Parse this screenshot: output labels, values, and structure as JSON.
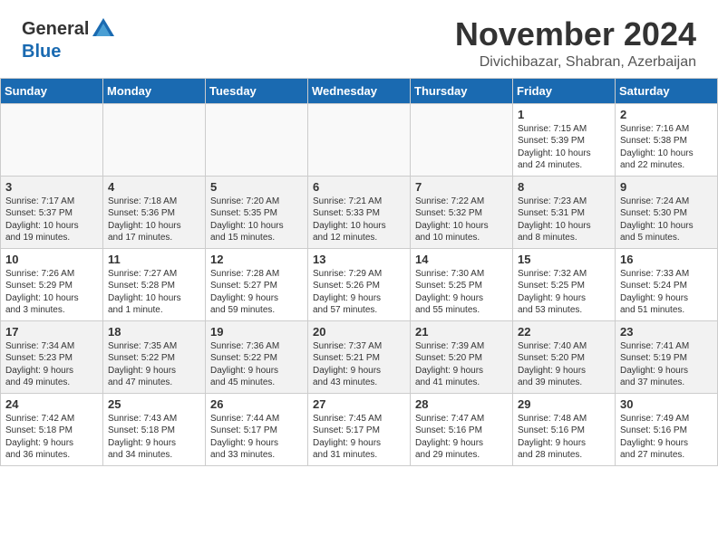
{
  "header": {
    "logo_general": "General",
    "logo_blue": "Blue",
    "month_title": "November 2024",
    "location": "Divichibazar, Shabran, Azerbaijan"
  },
  "days_of_week": [
    "Sunday",
    "Monday",
    "Tuesday",
    "Wednesday",
    "Thursday",
    "Friday",
    "Saturday"
  ],
  "weeks": [
    [
      {
        "day": "",
        "info": ""
      },
      {
        "day": "",
        "info": ""
      },
      {
        "day": "",
        "info": ""
      },
      {
        "day": "",
        "info": ""
      },
      {
        "day": "",
        "info": ""
      },
      {
        "day": "1",
        "info": "Sunrise: 7:15 AM\nSunset: 5:39 PM\nDaylight: 10 hours\nand 24 minutes."
      },
      {
        "day": "2",
        "info": "Sunrise: 7:16 AM\nSunset: 5:38 PM\nDaylight: 10 hours\nand 22 minutes."
      }
    ],
    [
      {
        "day": "3",
        "info": "Sunrise: 7:17 AM\nSunset: 5:37 PM\nDaylight: 10 hours\nand 19 minutes."
      },
      {
        "day": "4",
        "info": "Sunrise: 7:18 AM\nSunset: 5:36 PM\nDaylight: 10 hours\nand 17 minutes."
      },
      {
        "day": "5",
        "info": "Sunrise: 7:20 AM\nSunset: 5:35 PM\nDaylight: 10 hours\nand 15 minutes."
      },
      {
        "day": "6",
        "info": "Sunrise: 7:21 AM\nSunset: 5:33 PM\nDaylight: 10 hours\nand 12 minutes."
      },
      {
        "day": "7",
        "info": "Sunrise: 7:22 AM\nSunset: 5:32 PM\nDaylight: 10 hours\nand 10 minutes."
      },
      {
        "day": "8",
        "info": "Sunrise: 7:23 AM\nSunset: 5:31 PM\nDaylight: 10 hours\nand 8 minutes."
      },
      {
        "day": "9",
        "info": "Sunrise: 7:24 AM\nSunset: 5:30 PM\nDaylight: 10 hours\nand 5 minutes."
      }
    ],
    [
      {
        "day": "10",
        "info": "Sunrise: 7:26 AM\nSunset: 5:29 PM\nDaylight: 10 hours\nand 3 minutes."
      },
      {
        "day": "11",
        "info": "Sunrise: 7:27 AM\nSunset: 5:28 PM\nDaylight: 10 hours\nand 1 minute."
      },
      {
        "day": "12",
        "info": "Sunrise: 7:28 AM\nSunset: 5:27 PM\nDaylight: 9 hours\nand 59 minutes."
      },
      {
        "day": "13",
        "info": "Sunrise: 7:29 AM\nSunset: 5:26 PM\nDaylight: 9 hours\nand 57 minutes."
      },
      {
        "day": "14",
        "info": "Sunrise: 7:30 AM\nSunset: 5:25 PM\nDaylight: 9 hours\nand 55 minutes."
      },
      {
        "day": "15",
        "info": "Sunrise: 7:32 AM\nSunset: 5:25 PM\nDaylight: 9 hours\nand 53 minutes."
      },
      {
        "day": "16",
        "info": "Sunrise: 7:33 AM\nSunset: 5:24 PM\nDaylight: 9 hours\nand 51 minutes."
      }
    ],
    [
      {
        "day": "17",
        "info": "Sunrise: 7:34 AM\nSunset: 5:23 PM\nDaylight: 9 hours\nand 49 minutes."
      },
      {
        "day": "18",
        "info": "Sunrise: 7:35 AM\nSunset: 5:22 PM\nDaylight: 9 hours\nand 47 minutes."
      },
      {
        "day": "19",
        "info": "Sunrise: 7:36 AM\nSunset: 5:22 PM\nDaylight: 9 hours\nand 45 minutes."
      },
      {
        "day": "20",
        "info": "Sunrise: 7:37 AM\nSunset: 5:21 PM\nDaylight: 9 hours\nand 43 minutes."
      },
      {
        "day": "21",
        "info": "Sunrise: 7:39 AM\nSunset: 5:20 PM\nDaylight: 9 hours\nand 41 minutes."
      },
      {
        "day": "22",
        "info": "Sunrise: 7:40 AM\nSunset: 5:20 PM\nDaylight: 9 hours\nand 39 minutes."
      },
      {
        "day": "23",
        "info": "Sunrise: 7:41 AM\nSunset: 5:19 PM\nDaylight: 9 hours\nand 37 minutes."
      }
    ],
    [
      {
        "day": "24",
        "info": "Sunrise: 7:42 AM\nSunset: 5:18 PM\nDaylight: 9 hours\nand 36 minutes."
      },
      {
        "day": "25",
        "info": "Sunrise: 7:43 AM\nSunset: 5:18 PM\nDaylight: 9 hours\nand 34 minutes."
      },
      {
        "day": "26",
        "info": "Sunrise: 7:44 AM\nSunset: 5:17 PM\nDaylight: 9 hours\nand 33 minutes."
      },
      {
        "day": "27",
        "info": "Sunrise: 7:45 AM\nSunset: 5:17 PM\nDaylight: 9 hours\nand 31 minutes."
      },
      {
        "day": "28",
        "info": "Sunrise: 7:47 AM\nSunset: 5:16 PM\nDaylight: 9 hours\nand 29 minutes."
      },
      {
        "day": "29",
        "info": "Sunrise: 7:48 AM\nSunset: 5:16 PM\nDaylight: 9 hours\nand 28 minutes."
      },
      {
        "day": "30",
        "info": "Sunrise: 7:49 AM\nSunset: 5:16 PM\nDaylight: 9 hours\nand 27 minutes."
      }
    ]
  ]
}
